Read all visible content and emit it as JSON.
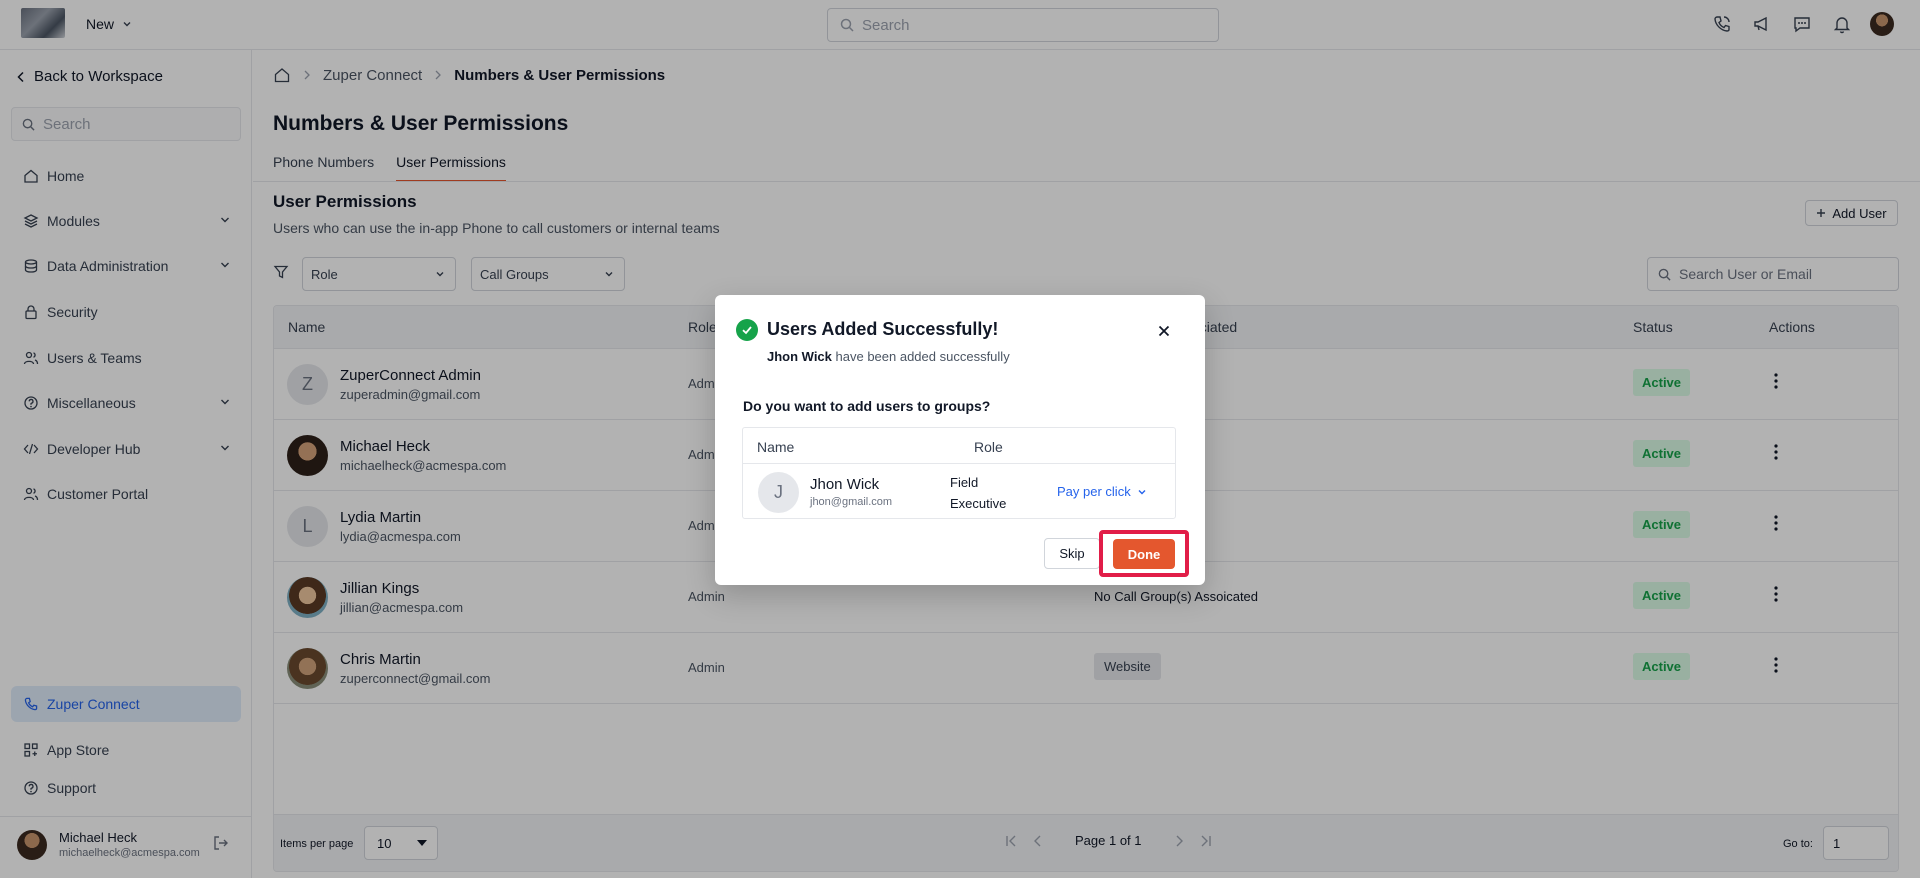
{
  "topbar": {
    "new_label": "New",
    "search_placeholder": "Search"
  },
  "sidebar": {
    "back_label": "Back to Workspace",
    "search_placeholder": "Search",
    "items": [
      {
        "label": "Home"
      },
      {
        "label": "Modules"
      },
      {
        "label": "Data Administration"
      },
      {
        "label": "Security"
      },
      {
        "label": "Users & Teams"
      },
      {
        "label": "Miscellaneous"
      },
      {
        "label": "Developer Hub"
      },
      {
        "label": "Customer Portal"
      }
    ],
    "bottom_items": [
      {
        "label": "Zuper Connect"
      },
      {
        "label": "App Store"
      },
      {
        "label": "Support"
      }
    ],
    "user": {
      "name": "Michael Heck",
      "email": "michaelheck@acmespa.com"
    }
  },
  "breadcrumb": [
    "Zuper Connect",
    "Numbers & User Permissions"
  ],
  "page_title": "Numbers & User Permissions",
  "tabs": [
    {
      "label": "Phone Numbers",
      "active": false
    },
    {
      "label": "User Permissions",
      "active": true
    }
  ],
  "section": {
    "title": "User Permissions",
    "subtitle": "Users who can use the in-app Phone to call customers or internal teams",
    "add_user_label": "Add User"
  },
  "filters": {
    "role_label": "Role",
    "call_groups_label": "Call Groups",
    "search_placeholder": "Search User or Email"
  },
  "table": {
    "headers": {
      "name": "Name",
      "role": "Role",
      "associated": "ociated",
      "status": "Status",
      "actions": "Actions"
    },
    "rows": [
      {
        "initial": "Z",
        "name": "ZuperConnect Admin",
        "email": "zuperadmin@gmail.com",
        "role": "Adm",
        "associated": "",
        "status": "Active"
      },
      {
        "initial": "",
        "name": "Michael Heck",
        "email": "michaelheck@acmespa.com",
        "role": "Adm",
        "associated": "",
        "status": "Active"
      },
      {
        "initial": "L",
        "name": "Lydia Martin",
        "email": "lydia@acmespa.com",
        "role": "Adm",
        "associated": "",
        "status": "Active"
      },
      {
        "initial": "",
        "name": "Jillian Kings",
        "email": "jillian@acmespa.com",
        "role": "Admin",
        "associated": "No Call Group(s) Assoicated",
        "status": "Active"
      },
      {
        "initial": "",
        "name": "Chris Martin",
        "email": "zuperconnect@gmail.com",
        "role": "Admin",
        "associated": "Website",
        "status": "Active"
      }
    ],
    "footer": {
      "items_per_page_label": "Items per page",
      "items_per_page": "10",
      "page_info": "Page 1 of 1",
      "goto_label": "Go to:",
      "goto_value": "1"
    }
  },
  "modal": {
    "title": "Users Added Successfully!",
    "subtitle_name": "Jhon Wick",
    "subtitle_rest": " have been added successfully",
    "question": "Do you want to add users to groups?",
    "headers": {
      "name": "Name",
      "role": "Role"
    },
    "user": {
      "initial": "J",
      "name": "Jhon Wick",
      "email": "jhon@gmail.com",
      "role": "Field Executive",
      "group": "Pay per click"
    },
    "skip_label": "Skip",
    "done_label": "Done"
  },
  "colors": {
    "accent": "#e4572e",
    "link": "#2563eb",
    "status_active": "#16a34a",
    "highlight": "#e11d48"
  }
}
